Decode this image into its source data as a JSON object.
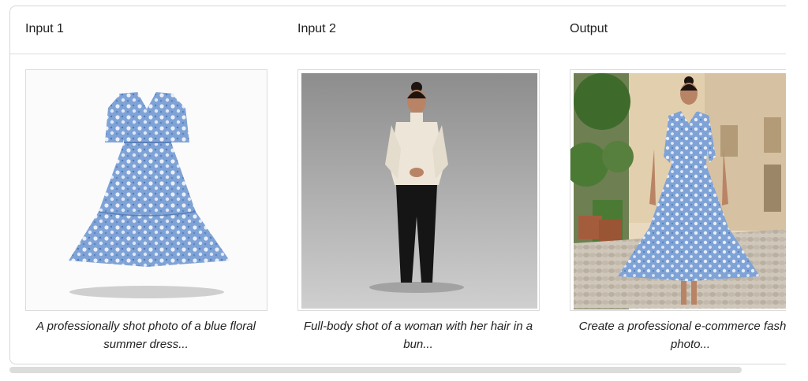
{
  "columns": [
    {
      "header": "Input 1",
      "caption": "A professionally shot photo of a blue floral summer dress..."
    },
    {
      "header": "Input 2",
      "caption": "Full-body shot of a woman with her hair in a bun..."
    },
    {
      "header": "Output",
      "caption": "Create a professional e-commerce fashion photo..."
    }
  ],
  "images": {
    "input1": {
      "subject": "blue floral summer dress on white background"
    },
    "input2": {
      "subject": "woman in cream turtleneck and black pants, gray studio backdrop"
    },
    "output": {
      "subject": "woman wearing the blue floral dress on a sunlit street"
    }
  },
  "colors": {
    "dress_blue": "#7fa3d6",
    "dress_light": "#b9cdee",
    "studio_gray": "#9b9b9b",
    "sweater": "#ede6d8",
    "pants": "#151515",
    "street_stone": "#c8bfb2",
    "foliage": "#3e6b2c"
  }
}
